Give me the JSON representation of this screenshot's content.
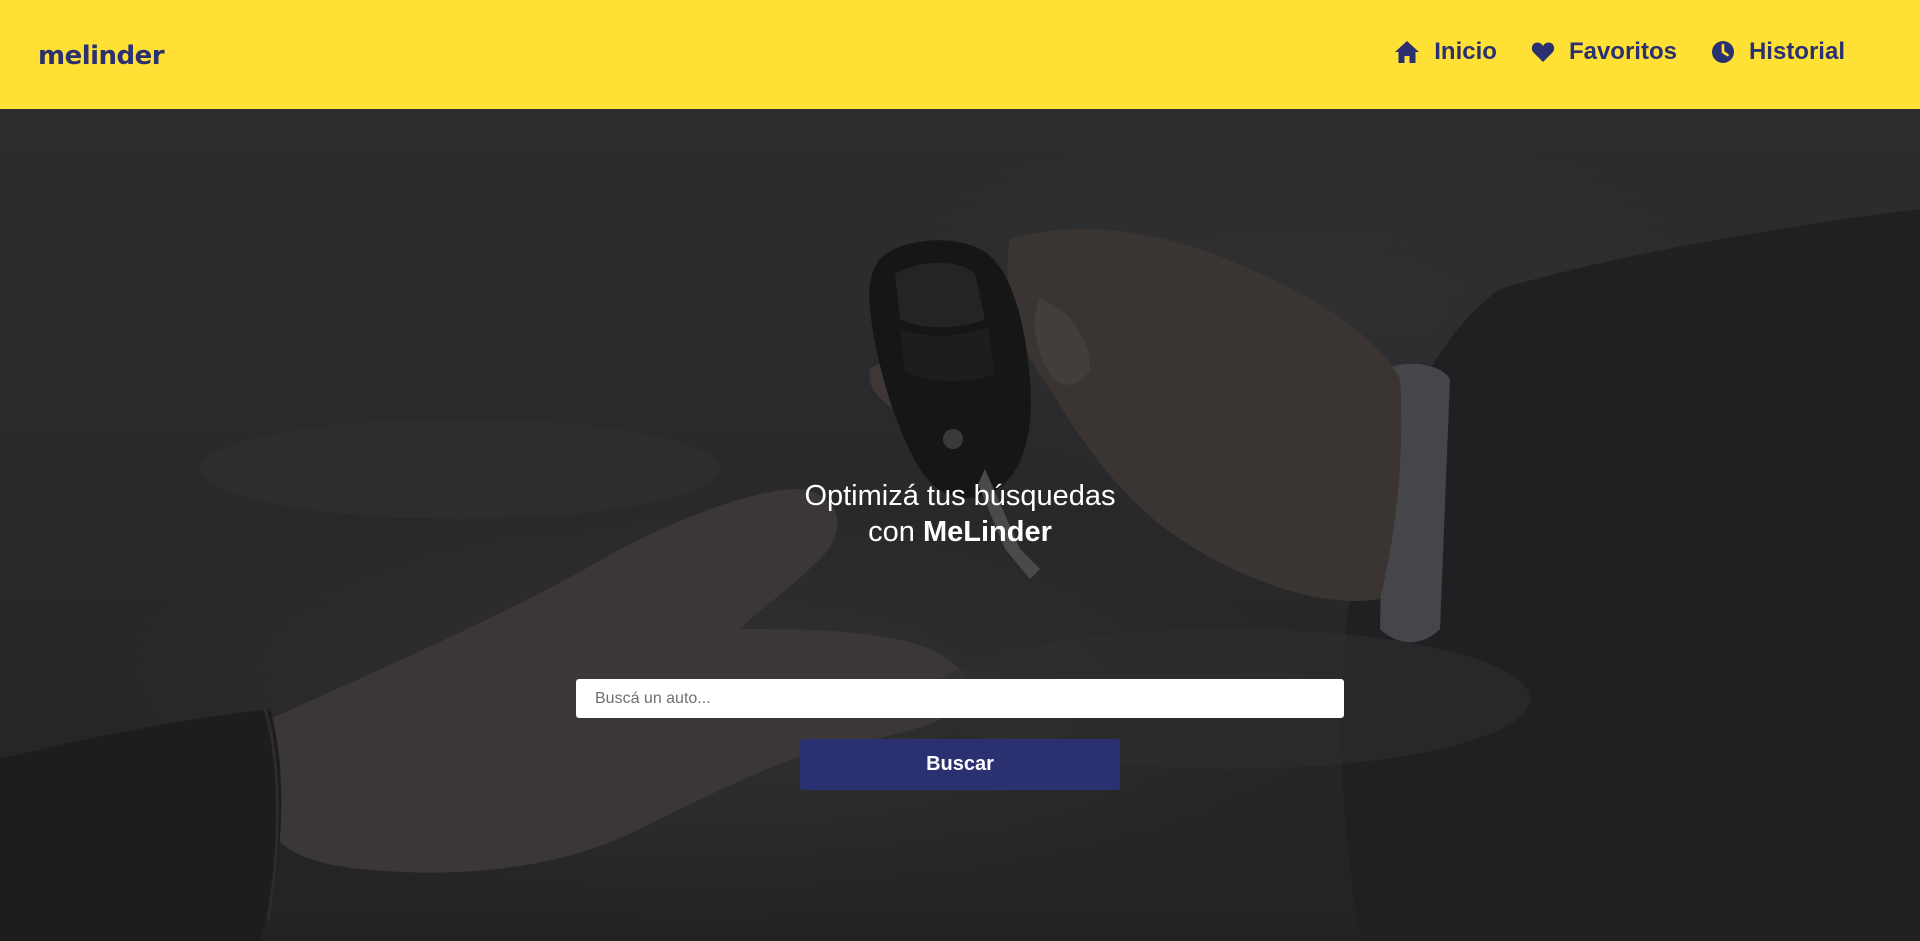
{
  "brand": {
    "logo_text": "melinder"
  },
  "nav": {
    "items": [
      {
        "label": "Inicio",
        "icon": "home-icon"
      },
      {
        "label": "Favoritos",
        "icon": "heart-icon"
      },
      {
        "label": "Historial",
        "icon": "clock-icon"
      }
    ]
  },
  "hero": {
    "title_line1": "Optimizá tus búsquedas",
    "title_prefix": "con ",
    "title_brand": "MeLinder",
    "search_placeholder": "Buscá un auto...",
    "search_value": "",
    "search_button_label": "Buscar"
  },
  "colors": {
    "header_background": "#ffe136",
    "brand_navy": "#2b3170",
    "hero_overlay": "#2a2a2c",
    "text_light": "#ffffff"
  }
}
